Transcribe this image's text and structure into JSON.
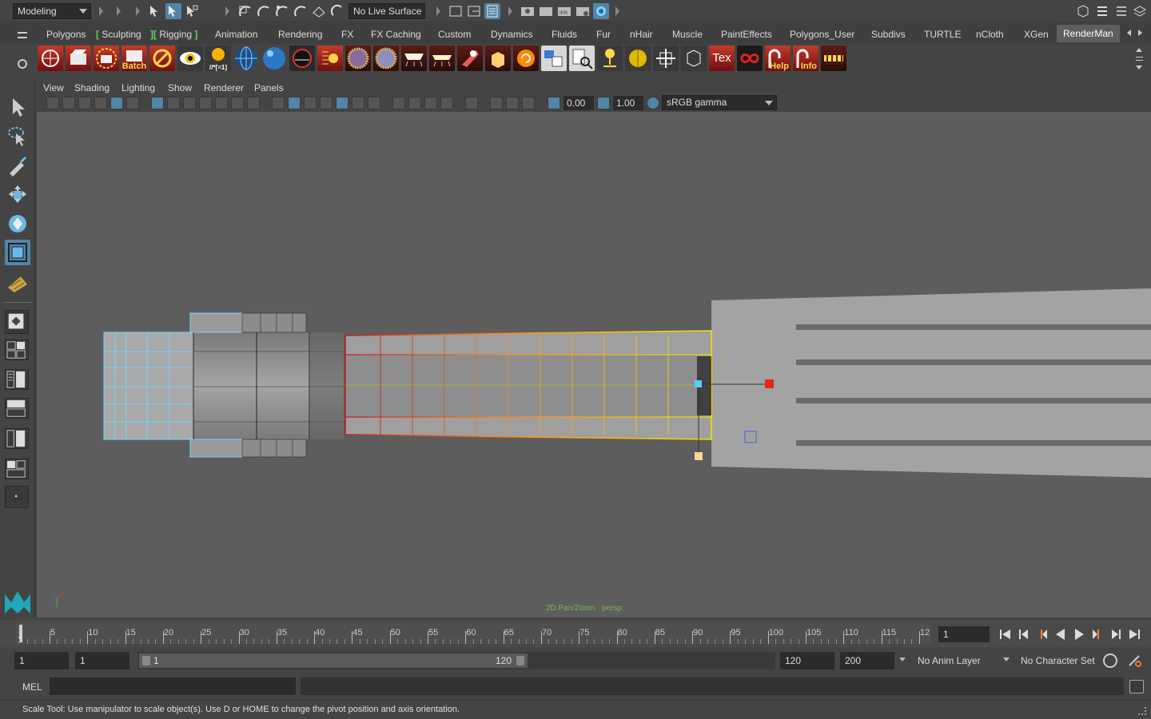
{
  "app": {
    "name": "Maya"
  },
  "topbar": {
    "menu_set": "Modeling",
    "live_surface": "No Live Surface"
  },
  "shelf_tabs": [
    {
      "label": "Polygons",
      "active": false
    },
    {
      "label": "Sculpting",
      "active": false
    },
    {
      "label": "Rigging",
      "active": false
    },
    {
      "label": "Animation",
      "active": false
    },
    {
      "label": "Rendering",
      "active": false
    },
    {
      "label": "FX",
      "active": false
    },
    {
      "label": "FX Caching",
      "active": false
    },
    {
      "label": "Custom",
      "active": false
    },
    {
      "label": "Dynamics",
      "active": false
    },
    {
      "label": "Fluids",
      "active": false
    },
    {
      "label": "Fur",
      "active": false
    },
    {
      "label": "nHair",
      "active": false
    },
    {
      "label": "Muscle",
      "active": false
    },
    {
      "label": "PaintEffects",
      "active": false
    },
    {
      "label": "Polygons_User",
      "active": false
    },
    {
      "label": "Subdivs",
      "active": false
    },
    {
      "label": "TURTLE",
      "active": false
    },
    {
      "label": "nCloth",
      "active": false
    },
    {
      "label": "XGen",
      "active": false
    },
    {
      "label": "RenderMan",
      "active": true
    }
  ],
  "shelf": {
    "batch_label": "Batch",
    "expr_label": "//*[=1]",
    "tex_label": "Tex",
    "help_label": "Help",
    "info_label": "Info"
  },
  "panel_menu": [
    "View",
    "Shading",
    "Lighting",
    "Show",
    "Renderer",
    "Panels"
  ],
  "panel_toolbar": {
    "exposure": "0.00",
    "gamma": "1.00",
    "color_space": "sRGB gamma"
  },
  "viewport": {
    "caption": "2D Pan/Zoom : persp",
    "active_tool": "scale-tool"
  },
  "timeline": {
    "ticks": [
      "5",
      "10",
      "15",
      "20",
      "25",
      "30",
      "35",
      "40",
      "45",
      "50",
      "55",
      "60",
      "65",
      "70",
      "75",
      "80",
      "85",
      "90",
      "95",
      "100",
      "105",
      "110",
      "115",
      "12"
    ],
    "first_frame_label": "1",
    "current_frame": "1"
  },
  "range": {
    "start_frame": "1",
    "playback_start": "1",
    "slider_start": "1",
    "slider_end": "120",
    "playback_end": "120",
    "end_frame": "200",
    "anim_layer": "No Anim Layer",
    "character_set": "No Character Set"
  },
  "command_line": {
    "language": "MEL",
    "input": "",
    "output": ""
  },
  "help_line": {
    "text": "Scale Tool: Use manipulator to scale object(s). Use D or HOME to change the pivot position and axis orientation."
  },
  "colors": {
    "accent": "#5285a6",
    "selection_yellow": "#e8e000",
    "hilite_cyan": "#6fd8ff",
    "manip_red": "#e0281c"
  }
}
